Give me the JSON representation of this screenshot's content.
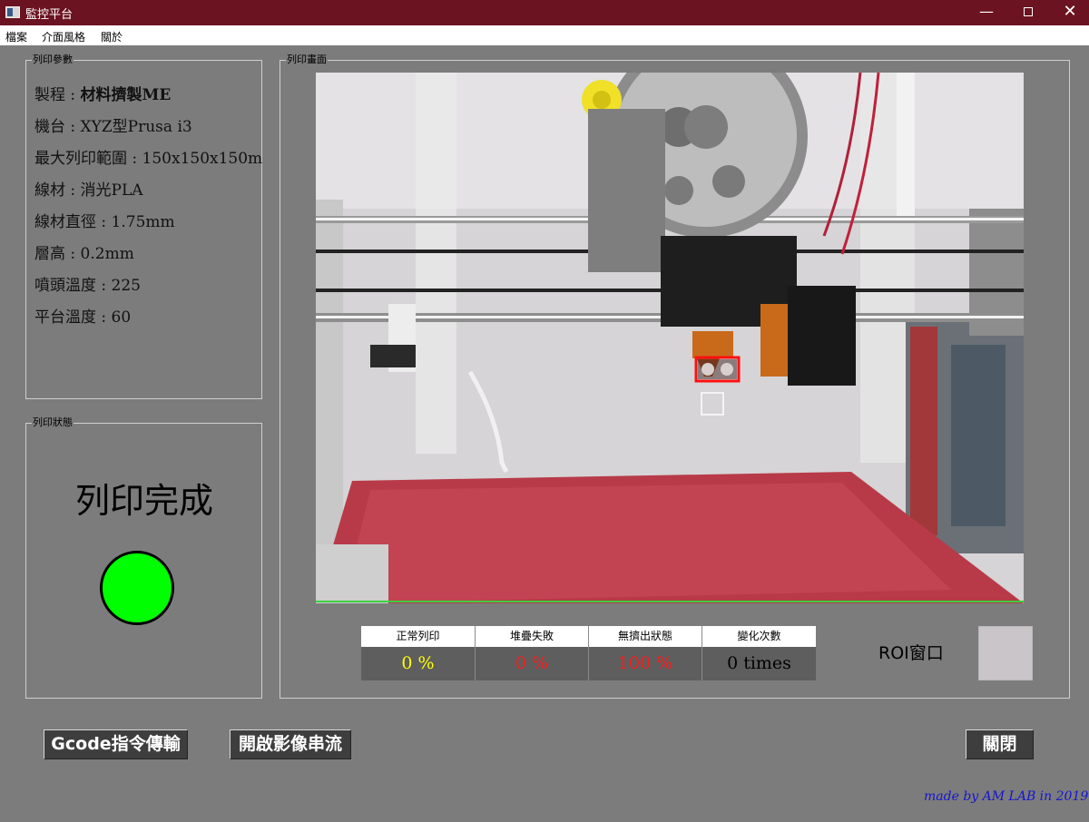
{
  "window": {
    "title": "監控平台",
    "minimize": "—",
    "close": "✕"
  },
  "menu": {
    "file": "檔案",
    "style": "介面風格",
    "about": "關於"
  },
  "params": {
    "group_title": "列印參數",
    "process_label": "製程 : ",
    "process_value": "材料擠製ME",
    "machine": "機台 : XYZ型Prusa i3",
    "range": "最大列印範圍 : 150x150x150m",
    "filament": "線材 : 消光PLA",
    "diameter": "線材直徑 : 1.75mm",
    "layer": "層高 : 0.2mm",
    "nozzle_temp": "噴頭溫度 : 225",
    "bed_temp": "平台溫度 : 60"
  },
  "status": {
    "group_title": "列印狀態",
    "text": "列印完成",
    "light_color": "#00ff00"
  },
  "camera": {
    "group_title": "列印畫面"
  },
  "stats": [
    {
      "header": "正常列印",
      "value": "0 %",
      "color": "#ffff00"
    },
    {
      "header": "堆疊失敗",
      "value": "0 %",
      "color": "#ff1a1a"
    },
    {
      "header": "無擠出狀態",
      "value": "100 %",
      "color": "#ff1a1a"
    },
    {
      "header": "變化次數",
      "value": "0 times",
      "color": "#000000"
    }
  ],
  "roi_label": "ROI窗口",
  "buttons": {
    "gcode": "Gcode指令傳輸",
    "stream": "開啟影像串流",
    "close": "關閉"
  },
  "credit": "made by AM LAB in 2019",
  "colors": {
    "titlebar": "#6b1320",
    "background": "#7c7c7c",
    "credit": "#1515d0"
  }
}
